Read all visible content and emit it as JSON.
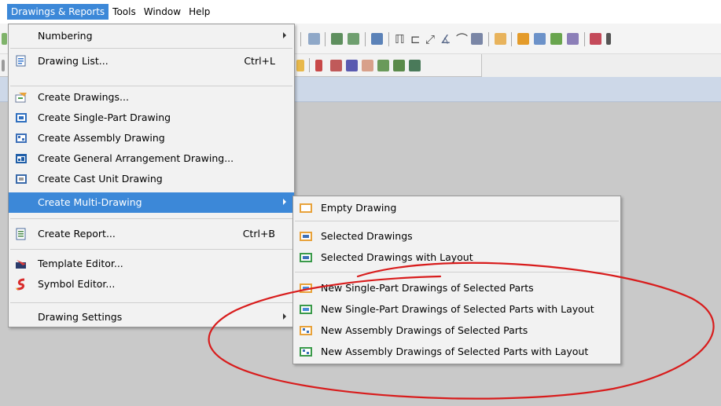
{
  "menubar": {
    "items": [
      "Drawings & Reports",
      "Tools",
      "Window",
      "Help"
    ],
    "active_index": 0
  },
  "menu": {
    "items": [
      {
        "label": "Numbering",
        "shortcut": "",
        "submenu": true,
        "icon": "none"
      },
      {
        "label": "Drawing List...",
        "shortcut": "Ctrl+L",
        "submenu": false,
        "icon": "drawing-list-icon"
      },
      {
        "label": "Create Drawings...",
        "shortcut": "",
        "submenu": false,
        "icon": "create-drawings-icon"
      },
      {
        "label": "Create Single-Part Drawing",
        "shortcut": "",
        "submenu": false,
        "icon": "single-part-drawing-icon"
      },
      {
        "label": "Create Assembly Drawing",
        "shortcut": "",
        "submenu": false,
        "icon": "assembly-drawing-icon"
      },
      {
        "label": "Create General Arrangement Drawing...",
        "shortcut": "",
        "submenu": false,
        "icon": "ga-drawing-icon"
      },
      {
        "label": "Create Cast Unit Drawing",
        "shortcut": "",
        "submenu": false,
        "icon": "cast-unit-drawing-icon"
      },
      {
        "label": "Create Multi-Drawing",
        "shortcut": "",
        "submenu": true,
        "icon": "none"
      },
      {
        "label": "Create Report...",
        "shortcut": "Ctrl+B",
        "submenu": false,
        "icon": "report-icon"
      },
      {
        "label": "Template Editor...",
        "shortcut": "",
        "submenu": false,
        "icon": "template-editor-icon"
      },
      {
        "label": "Symbol Editor...",
        "shortcut": "",
        "submenu": false,
        "icon": "symbol-editor-icon"
      },
      {
        "label": "Drawing Settings",
        "shortcut": "",
        "submenu": true,
        "icon": "none"
      }
    ]
  },
  "submenu": {
    "items": [
      {
        "label": "Empty Drawing",
        "icon": "empty-drawing-icon"
      },
      {
        "label": "Selected Drawings",
        "icon": "selected-drawings-icon"
      },
      {
        "label": "Selected Drawings with Layout",
        "icon": "selected-drawings-layout-icon"
      },
      {
        "label": "New Single-Part Drawings of Selected Parts",
        "icon": "single-part-selected-icon"
      },
      {
        "label": "New Single-Part Drawings of Selected Parts with Layout",
        "icon": "single-part-selected-layout-icon"
      },
      {
        "label": "New Assembly Drawings of Selected Parts",
        "icon": "assembly-selected-icon"
      },
      {
        "label": "New Assembly Drawings of Selected Parts with Layout",
        "icon": "assembly-selected-layout-icon"
      }
    ]
  },
  "colors": {
    "highlight": "#3c88d8",
    "annotation": "#d81c1c"
  }
}
